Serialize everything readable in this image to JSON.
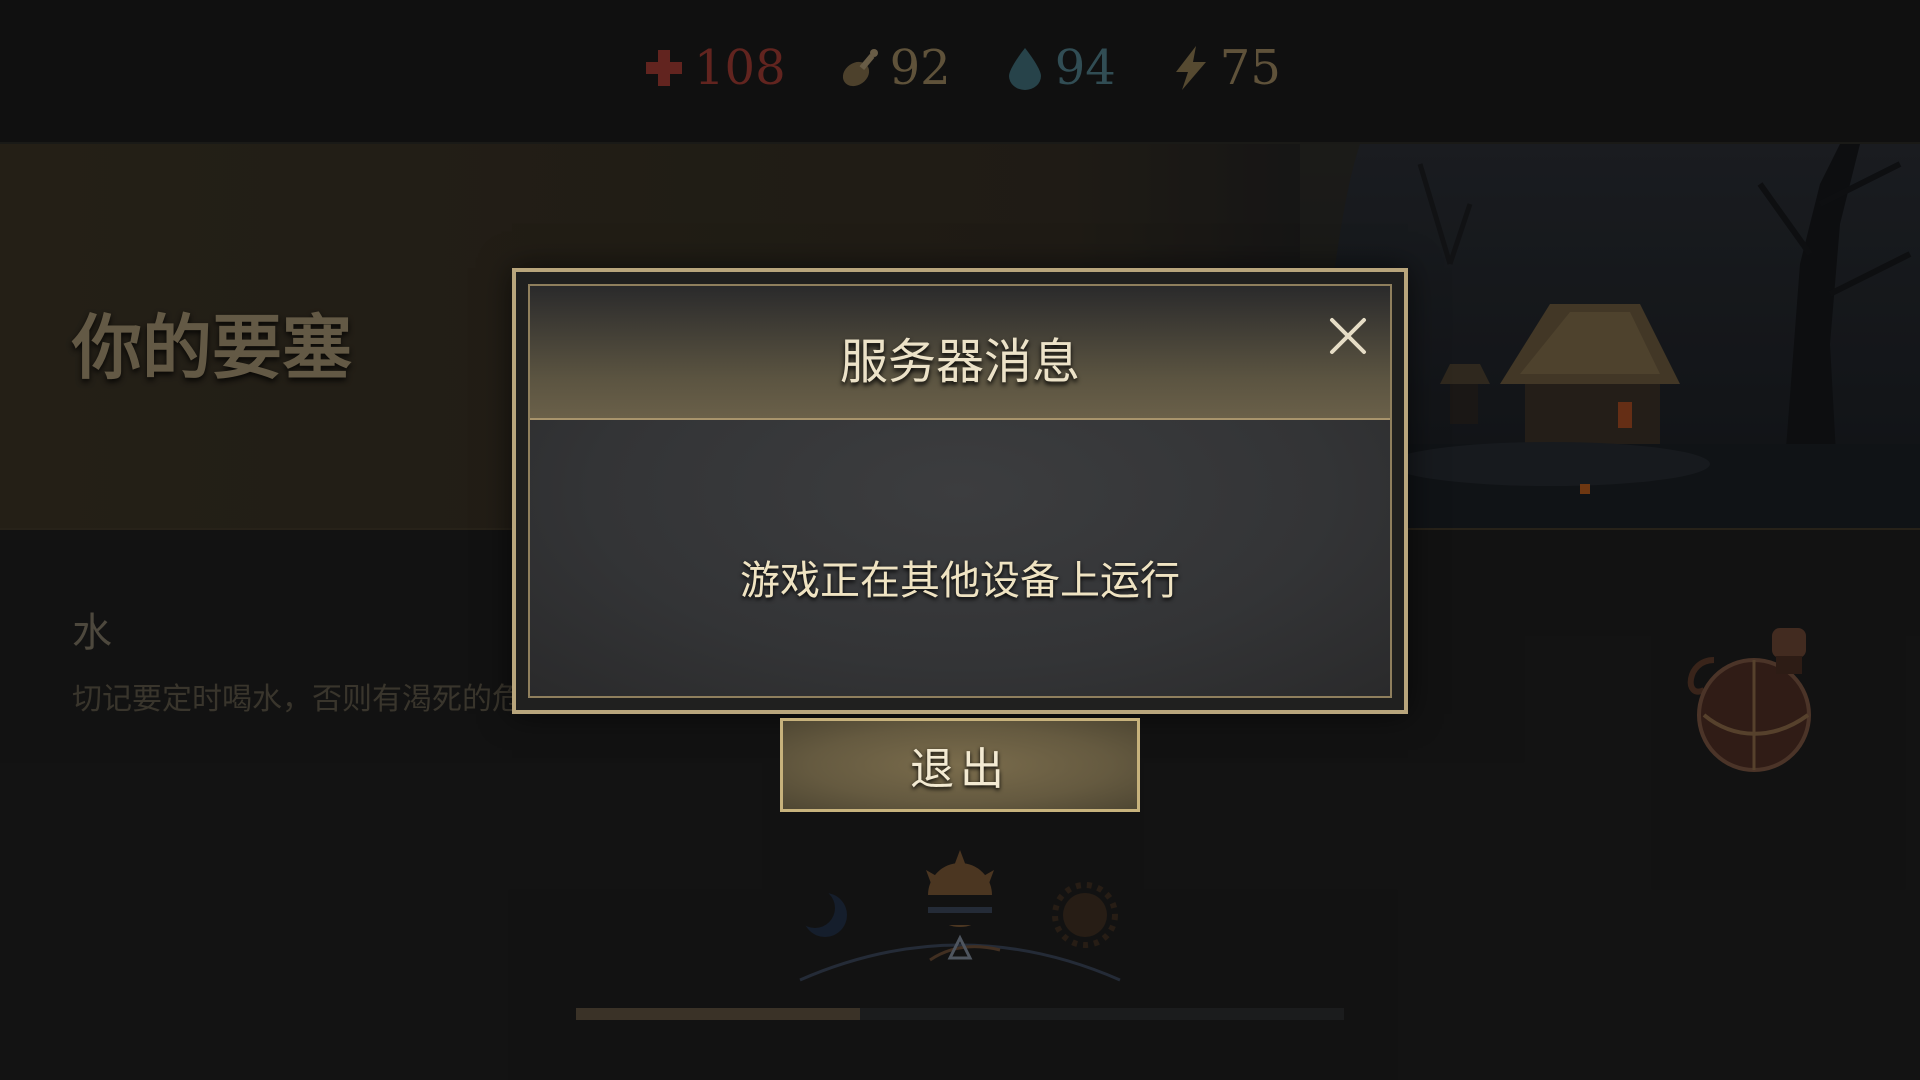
{
  "stats": {
    "health": {
      "value": "108",
      "icon": "health-cross-icon",
      "color": "#9e3b32"
    },
    "food": {
      "value": "92",
      "icon": "drumstick-icon",
      "color": "#9a855e"
    },
    "water": {
      "value": "94",
      "icon": "water-drop-icon",
      "color": "#4f7d88"
    },
    "energy": {
      "value": "75",
      "icon": "lightning-icon",
      "color": "#9a855e"
    }
  },
  "banner": {
    "title": "你的要塞"
  },
  "water_info": {
    "title": "水",
    "description": "切记要定时喝水，否则有渴死的危险。"
  },
  "day_cycle": {
    "icons": [
      "moon-icon",
      "sunrise-icon",
      "sun-icon"
    ],
    "progress": 0.37
  },
  "dialog": {
    "title": "服务器消息",
    "message": "游戏正在其他设备上运行",
    "exit_label": "退出",
    "close_icon": "close-icon"
  }
}
